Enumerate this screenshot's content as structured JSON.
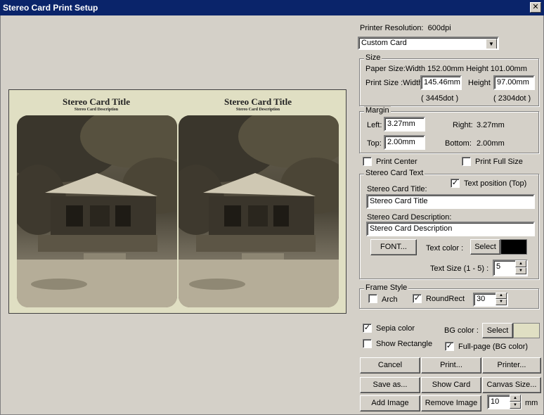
{
  "window": {
    "title": "Stereo Card Print Setup",
    "close_glyph": "✕"
  },
  "preview": {
    "bg_color": "#e0dfc3",
    "left_title": "Stereo Card Title",
    "left_desc": "Stereo Card Description",
    "right_title": "Stereo Card Title",
    "right_desc": "Stereo Card Description"
  },
  "printer_resolution": {
    "label": "Printer Resolution:",
    "value": "600dpi"
  },
  "card_type": {
    "selected": "Custom Card"
  },
  "size": {
    "group_title": "Size",
    "paper_size": "Paper Size:Width 152.00mm Height 101.00mm",
    "print_size_label": "Print Size :Width",
    "width_value": "145.46mm",
    "height_label": "Height",
    "height_value": "97.00mm",
    "width_dots": "( 3445dot )",
    "height_dots": "( 2304dot )"
  },
  "margin": {
    "group_title": "Margin",
    "left_label": "Left:",
    "left_value": "3.27mm",
    "top_label": "Top:",
    "top_value": "2.00mm",
    "right_label": "Right:",
    "right_value": "3.27mm",
    "bottom_label": "Bottom:",
    "bottom_value": "2.00mm"
  },
  "options": {
    "print_center": "Print Center",
    "print_full_size": "Print Full Size"
  },
  "stereo_text": {
    "group_title": "Stereo Card Text",
    "title_label": "Stereo Card Title:",
    "text_position": "Text position (Top)",
    "title_value": "Stereo Card Title",
    "desc_label": "Stereo Card Description:",
    "desc_value": "Stereo Card Description",
    "font_button": "FONT...",
    "text_color_label": "Text color :",
    "select_button": "Select",
    "text_color": "#000000",
    "text_size_label": "Text Size (1 - 5) :",
    "text_size_value": "5"
  },
  "frame_style": {
    "group_title": "Frame Style",
    "arch": "Arch",
    "roundrect": "RoundRect",
    "radius_value": "30"
  },
  "appearance": {
    "sepia": "Sepia color",
    "show_rectangle": "Show Rectangle",
    "bg_color_label": "BG color :",
    "select_button": "Select",
    "bg_color": "#e0dfc3",
    "full_page": "Full-page (BG color)"
  },
  "buttons": {
    "cancel": "Cancel",
    "print": "Print...",
    "printer": "Printer...",
    "save_as": "Save as...",
    "show_card": "Show Card",
    "canvas_size": "Canvas Size...",
    "add_image": "Add Image",
    "remove_image": "Remove Image"
  },
  "spacing": {
    "value": "10",
    "unit": "mm"
  },
  "check_glyph": "✓"
}
